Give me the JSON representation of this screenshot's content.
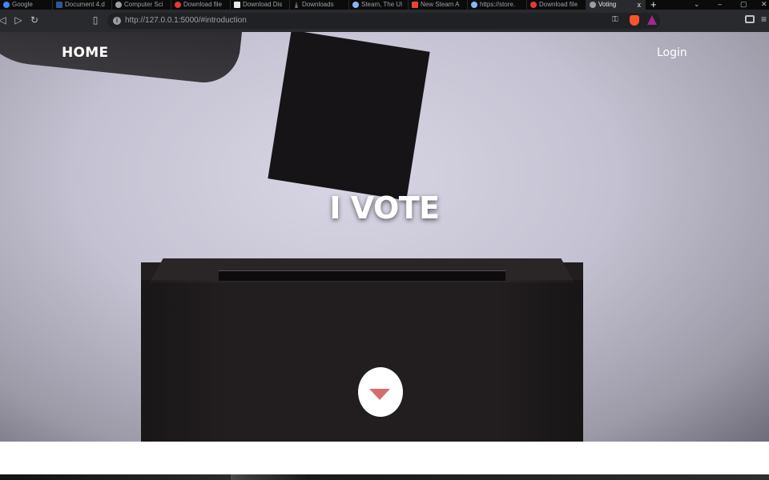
{
  "browser": {
    "tabs": [
      {
        "title": "Google",
        "active": false,
        "icon": "google-icon",
        "color": "#4285f4"
      },
      {
        "title": "Document 4.d",
        "active": false,
        "icon": "word-icon",
        "color": "#2b579a"
      },
      {
        "title": "Computer Sci",
        "active": false,
        "icon": "globe-icon",
        "color": "#9aa0a6"
      },
      {
        "title": "Download file",
        "active": false,
        "icon": "heart-icon",
        "color": "#e53935"
      },
      {
        "title": "Download Dis",
        "active": false,
        "icon": "doc-icon",
        "color": "#e8eaed"
      },
      {
        "title": "Downloads",
        "active": false,
        "icon": "download-icon",
        "color": "#e8eaed"
      },
      {
        "title": "Steam, The Ul",
        "active": false,
        "icon": "steam-icon",
        "color": "#8ab4f8"
      },
      {
        "title": "New Steam A",
        "active": false,
        "icon": "gmail-icon",
        "color": "#ea4335"
      },
      {
        "title": "https://store.",
        "active": false,
        "icon": "steam-icon",
        "color": "#8ab4f8"
      },
      {
        "title": "Download file",
        "active": false,
        "icon": "heart-icon",
        "color": "#e53935"
      },
      {
        "title": "Voting",
        "active": true,
        "icon": "globe-icon",
        "color": "#9aa0a6"
      }
    ],
    "url": "http://127.0.0.1:5000/#introduction",
    "tab_close": "x",
    "new_tab": "+"
  },
  "site": {
    "nav_home": "HOME",
    "nav_login": "Login",
    "hero_title": "I VOTE",
    "scroll_arrow_color": "#d26f6c"
  }
}
